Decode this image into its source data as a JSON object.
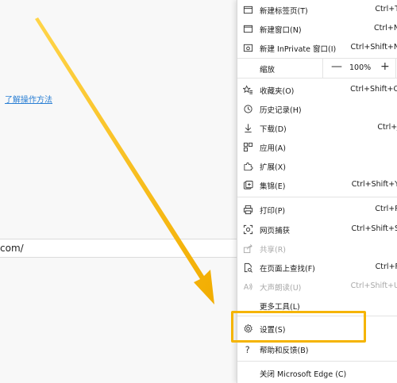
{
  "page": {
    "help_link": "了解操作方法",
    "url_fragment": "com/"
  },
  "menu": {
    "new_tab": {
      "label": "新建标签页(T)",
      "shortcut": "Ctrl+T"
    },
    "new_window": {
      "label": "新建窗口(N)",
      "shortcut": "Ctrl+N"
    },
    "new_inprivate": {
      "label": "新建 InPrivate 窗口(I)",
      "shortcut": "Ctrl+Shift+N"
    },
    "zoom": {
      "label": "缩放",
      "minus": "—",
      "value": "100%",
      "plus": "+"
    },
    "favorites": {
      "label": "收藏夹(O)",
      "shortcut": "Ctrl+Shift+O"
    },
    "history": {
      "label": "历史记录(H)",
      "shortcut": ""
    },
    "downloads": {
      "label": "下载(D)",
      "shortcut": "Ctrl+J"
    },
    "apps": {
      "label": "应用(A)",
      "shortcut": ""
    },
    "extensions": {
      "label": "扩展(X)",
      "shortcut": ""
    },
    "collections": {
      "label": "集锦(E)",
      "shortcut": "Ctrl+Shift+Y"
    },
    "print": {
      "label": "打印(P)",
      "shortcut": "Ctrl+P"
    },
    "web_capture": {
      "label": "网页捕获",
      "shortcut": "Ctrl+Shift+S"
    },
    "share": {
      "label": "共享(R)",
      "shortcut": ""
    },
    "find": {
      "label": "在页面上查找(F)",
      "shortcut": "Ctrl+F"
    },
    "read_aloud": {
      "label": "大声朗读(U)",
      "shortcut": "Ctrl+Shift+U"
    },
    "more_tools": {
      "label": "更多工具(L)",
      "shortcut": ""
    },
    "settings": {
      "label": "设置(S)",
      "shortcut": ""
    },
    "help": {
      "label": "帮助和反馈(B)",
      "shortcut": ""
    },
    "close_edge": {
      "label": "关闭 Microsoft Edge (C)",
      "shortcut": ""
    }
  },
  "colors": {
    "highlight": "#f5b400",
    "arrow": "#f5b400",
    "link": "#2a7fd4"
  }
}
